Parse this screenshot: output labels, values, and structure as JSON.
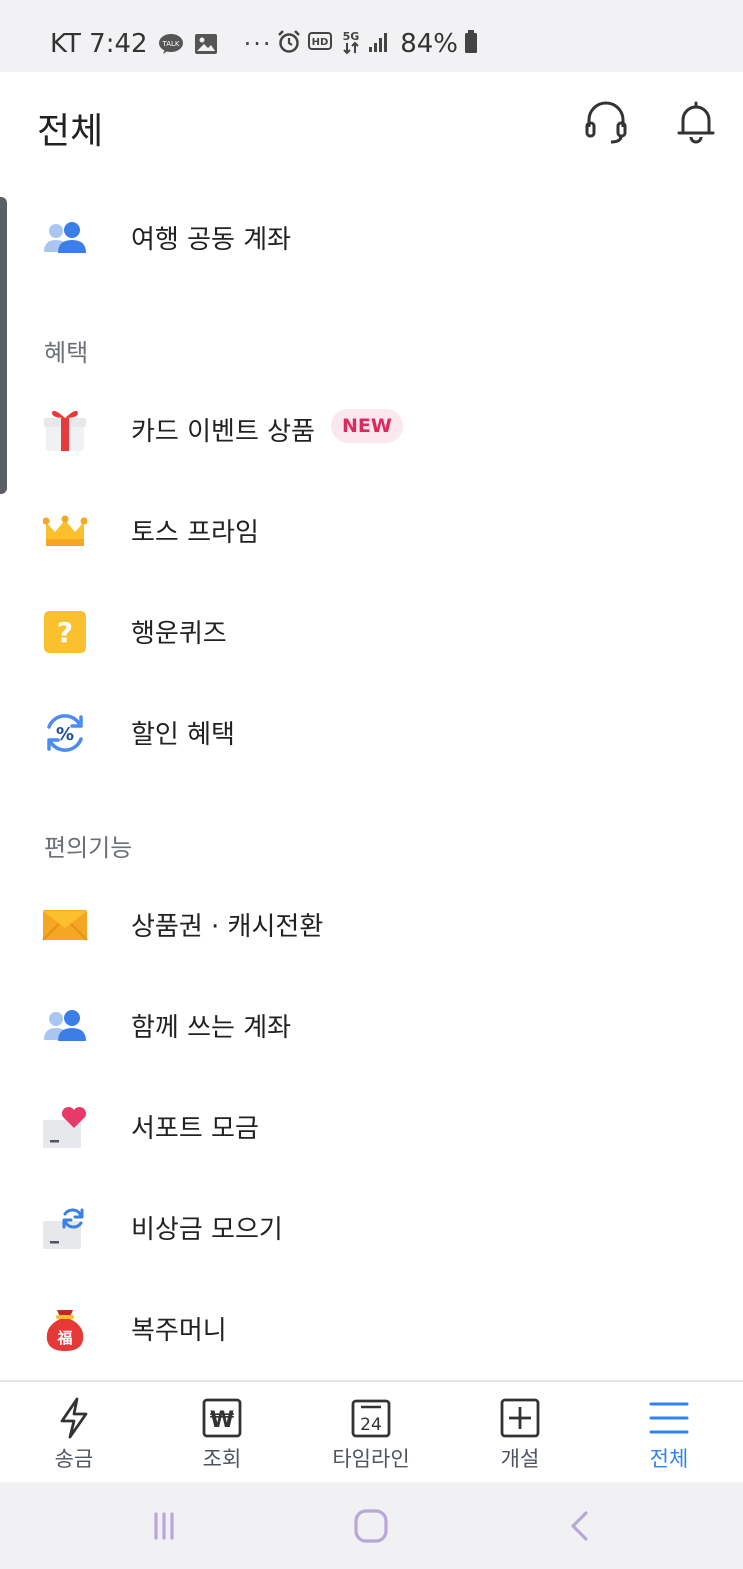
{
  "status_bar": {
    "carrier_time": "KT 7:42",
    "talk_badge": "TALK",
    "more": "···",
    "network": "5G",
    "hd": "HD",
    "battery": "84%"
  },
  "header": {
    "title": "전체"
  },
  "sections": {
    "benefits": "혜택",
    "convenience": "편의기능"
  },
  "items": {
    "travel_account": "여행 공동 계좌",
    "card_event": "카드 이벤트 상품",
    "new_badge": "NEW",
    "toss_prime": "토스 프라임",
    "lucky_quiz": "행운퀴즈",
    "discount": "할인 혜택",
    "gift_card": "상품권 · 캐시전환",
    "shared_account": "함께 쓰는 계좌",
    "support_fund": "서포트 모금",
    "emergency_fund": "비상금 모으기",
    "lucky_money": "복주머니"
  },
  "icon_text": {
    "quiz": "?",
    "discount": "%",
    "lucky_money": "福",
    "calendar": "24",
    "won": "₩"
  },
  "tabs": {
    "send": "송금",
    "inquiry": "조회",
    "timeline": "타임라인",
    "open": "개설",
    "all": "전체"
  },
  "colors": {
    "accent": "#3182f6",
    "badge_text": "#e0295a",
    "badge_bg": "#fbe7ee",
    "section_text": "#6b6f76"
  }
}
